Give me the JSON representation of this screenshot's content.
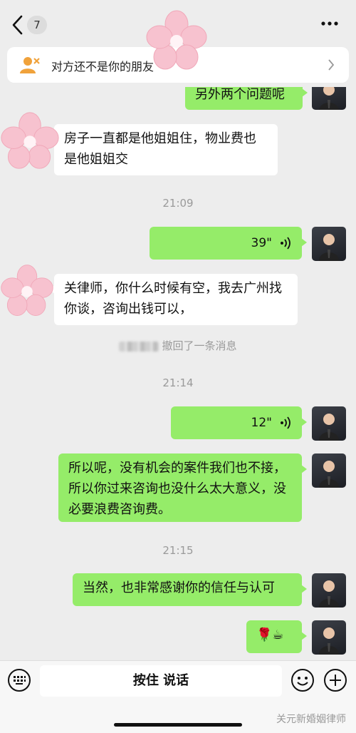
{
  "header": {
    "unread_count": "7"
  },
  "notice": {
    "text": "对方还不是你的朋友"
  },
  "messages": {
    "partial_top": "另外两个问题呢",
    "m1": "房子一直都是他姐姐住，物业费也是他姐姐交",
    "time1": "21:09",
    "voice1": "39\"",
    "m2": "关律师，你什么时候有空，我去广州找你谈，咨询出钱可以，",
    "recall": "撤回了一条消息",
    "time2": "21:14",
    "voice2": "12\"",
    "m3": "所以呢，没有机会的案件我们也不接，所以你过来咨询也没什么太大意义，没必要浪费咨询费。",
    "time3": "21:15",
    "m4": "当然，也非常感谢你的信任与认可",
    "m5": "🌹☕"
  },
  "inputbar": {
    "hold_to_talk": "按住 说话"
  },
  "watermark": "关元新婚姻律师",
  "colors": {
    "background": "#ededed",
    "bubble_self": "#95ec69",
    "bubble_other": "#ffffff"
  },
  "icons": [
    "back-chevron-icon",
    "more-dots-icon",
    "stranger-icon",
    "voice-wave-icon",
    "keyboard-icon",
    "emoji-icon",
    "plus-icon"
  ]
}
